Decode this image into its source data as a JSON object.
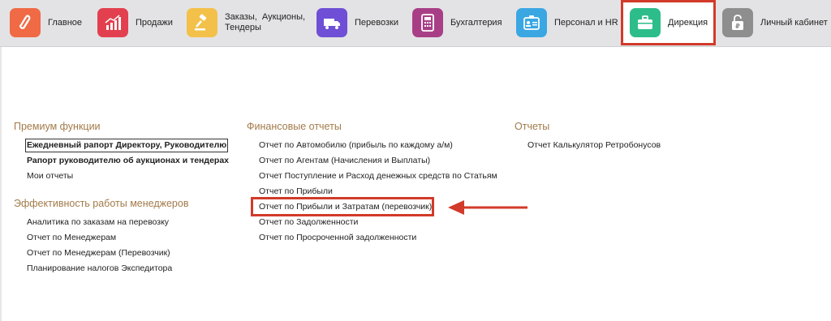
{
  "nav": {
    "items": [
      {
        "label": "Главное",
        "icon": "home-logo-icon",
        "color": "#ef6a45"
      },
      {
        "label": "Продажи",
        "icon": "bar-chart-icon",
        "color": "#e2404f"
      },
      {
        "label": "Заказы,  Аукционы,",
        "label2": "Тендеры",
        "icon": "gavel-icon",
        "color": "#f3c14a"
      },
      {
        "label": "Перевозки",
        "icon": "truck-icon",
        "color": "#6e4fd6"
      },
      {
        "label": "Бухгалтерия",
        "icon": "calculator-icon",
        "color": "#a83f86"
      },
      {
        "label": "Персонал и HR",
        "icon": "id-badge-icon",
        "color": "#3aa7e3"
      },
      {
        "label": "Дирекция",
        "icon": "briefcase-icon",
        "color": "#2dbd8b"
      },
      {
        "label": "Личный кабинет",
        "icon": "ruble-lock-icon",
        "color": "#8e8e8e"
      }
    ],
    "active": "Дирекция"
  },
  "premium": {
    "title": "Премиум функции",
    "links": [
      "Ежедневный рапорт Директору, Руководителю",
      "Рапорт руководителю об аукционах и тендерах",
      "Мои отчеты"
    ]
  },
  "managers": {
    "title": "Эффективность работы менеджеров",
    "links": [
      "Аналитика по заказам на перевозку",
      "Отчет по Менеджерам",
      "Отчет по Менеджерам (Перевозчик)",
      "Планирование налогов Экспедитора"
    ]
  },
  "financial": {
    "title": "Финансовые отчеты",
    "links": [
      "Отчет по Автомобилю (прибыль по каждому а/м)",
      "Отчет по Агентам (Начисления и Выплаты)",
      "Отчет Поступление и Расход денежных средств по Статьям",
      "Отчет по Прибыли",
      "Отчет по Прибыли и Затратам (перевозчик)",
      "Отчет по Задолженности",
      "Отчет по Просроченной задолженности"
    ]
  },
  "reports": {
    "title": "Отчеты",
    "links": [
      "Отчет Калькулятор Ретробонусов"
    ]
  },
  "colors": {
    "highlight": "#d23a2a",
    "section_title": "#a27b4a",
    "topbar": "#e3e3e5"
  }
}
